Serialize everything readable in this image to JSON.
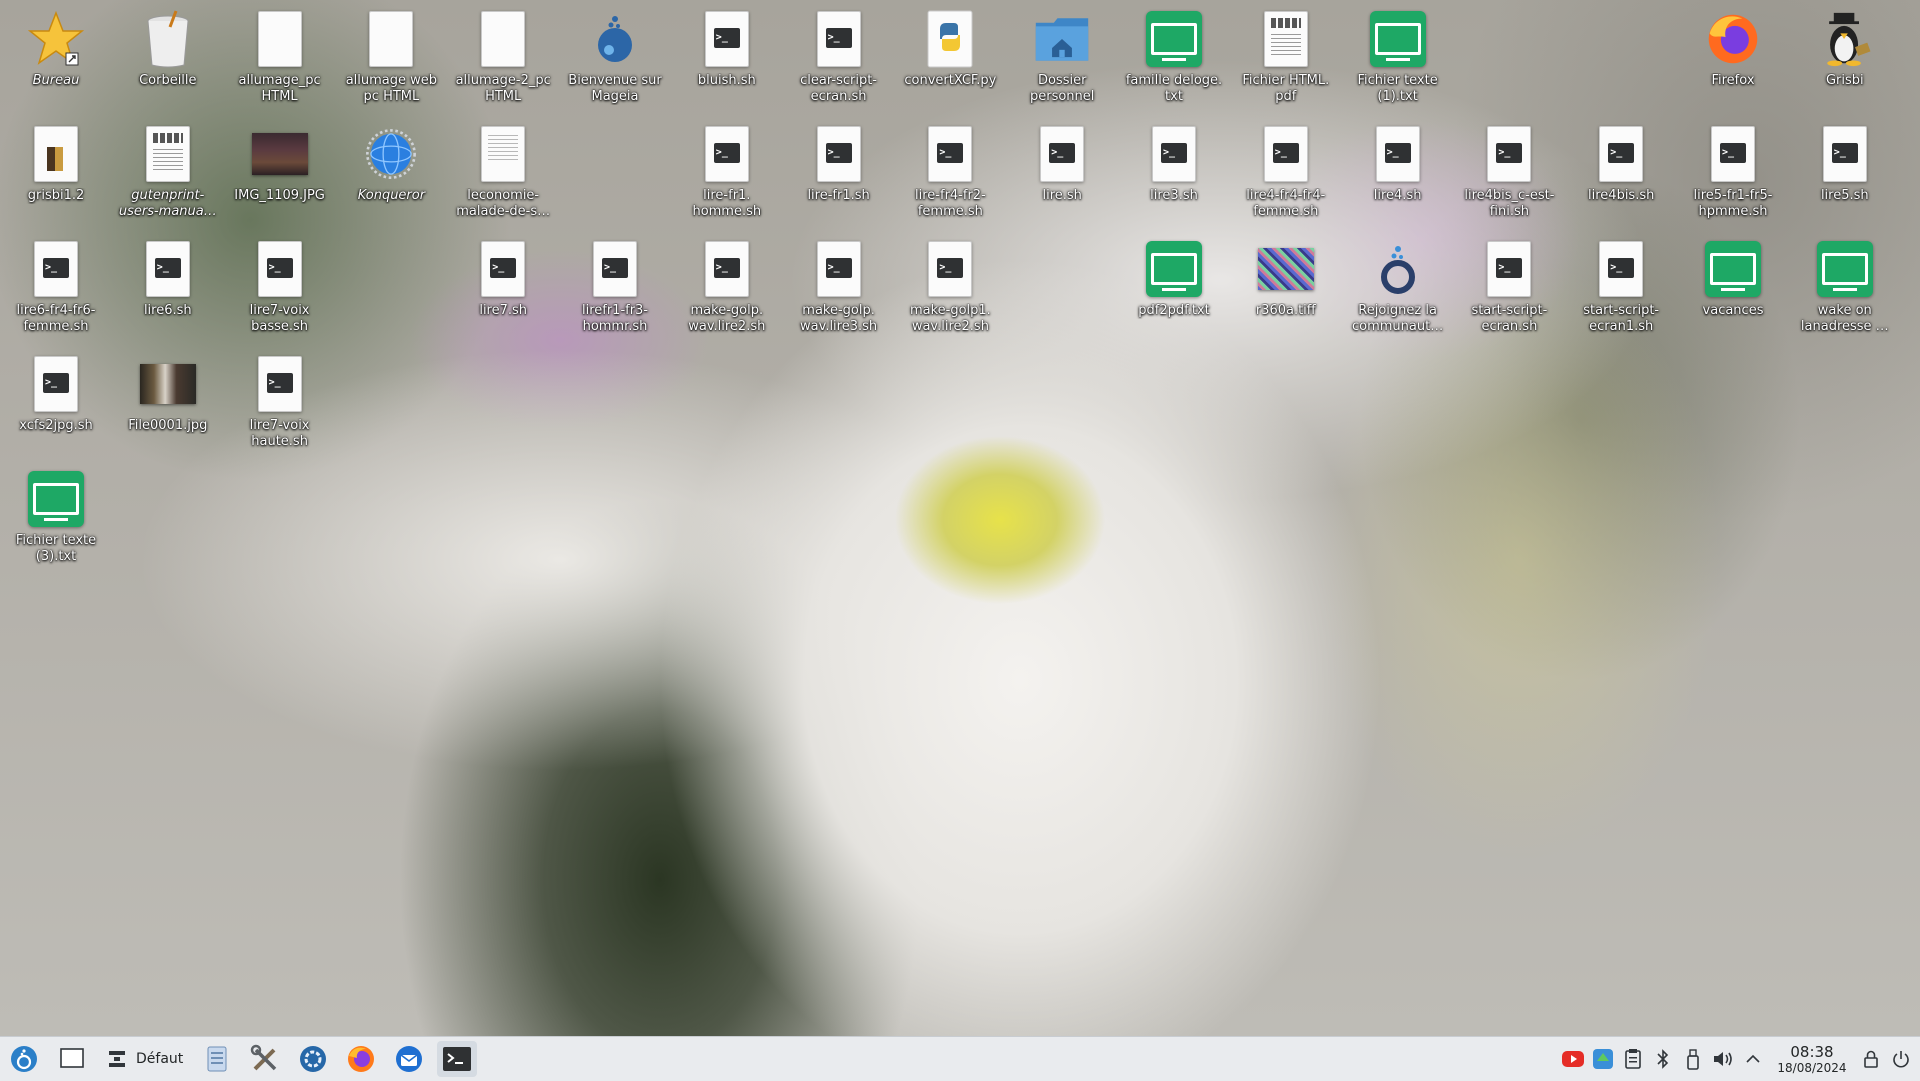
{
  "desktop": {
    "icons": [
      {
        "label": "Bureau",
        "type": "star",
        "col": 0,
        "row": 0,
        "italic": true
      },
      {
        "label": "Corbeille",
        "type": "trash",
        "col": 1,
        "row": 0
      },
      {
        "label": "allumage_pc HTML",
        "type": "page",
        "col": 2,
        "row": 0
      },
      {
        "label": "allumage web pc HTML",
        "type": "page",
        "col": 3,
        "row": 0
      },
      {
        "label": "allumage-2_pc HTML",
        "type": "page",
        "col": 4,
        "row": 0
      },
      {
        "label": "Bienvenue sur Mageia",
        "type": "mageia",
        "col": 5,
        "row": 0
      },
      {
        "label": "bluish.sh",
        "type": "script",
        "col": 6,
        "row": 0
      },
      {
        "label": "clear-script-ecran.sh",
        "type": "script",
        "col": 7,
        "row": 0
      },
      {
        "label": "convertXCF.py",
        "type": "python",
        "col": 8,
        "row": 0
      },
      {
        "label": "Dossier personnel",
        "type": "home",
        "col": 9,
        "row": 0
      },
      {
        "label": "famille deloge. txt",
        "type": "green",
        "col": 10,
        "row": 0
      },
      {
        "label": "Fichier HTML. pdf",
        "type": "pdfdoc",
        "col": 11,
        "row": 0
      },
      {
        "label": "Fichier texte (1).txt",
        "type": "green",
        "col": 12,
        "row": 0
      },
      {
        "label": "Firefox",
        "type": "firefox",
        "col": 15,
        "row": 0
      },
      {
        "label": "Grisbi",
        "type": "tux",
        "col": 16,
        "row": 0
      },
      {
        "label": "grisbi1.2",
        "type": "grisbi",
        "col": 0,
        "row": 1
      },
      {
        "label": "gutenprint-users-manua…",
        "type": "pdfdoc",
        "col": 1,
        "row": 1,
        "italic": true
      },
      {
        "label": "IMG_1109.JPG",
        "type": "photo",
        "col": 2,
        "row": 1
      },
      {
        "label": "Konqueror",
        "type": "konqueror",
        "col": 3,
        "row": 1,
        "italic": true
      },
      {
        "label": "leconomie-malade-de-s…",
        "type": "page-lines",
        "col": 4,
        "row": 1
      },
      {
        "label": "lire-fr1. homme.sh",
        "type": "script",
        "col": 6,
        "row": 1
      },
      {
        "label": "lire-fr1.sh",
        "type": "script",
        "col": 7,
        "row": 1
      },
      {
        "label": "lire-fr4-fr2-femme.sh",
        "type": "script",
        "col": 8,
        "row": 1
      },
      {
        "label": "lire.sh",
        "type": "script",
        "col": 9,
        "row": 1
      },
      {
        "label": "lire3.sh",
        "type": "script",
        "col": 10,
        "row": 1
      },
      {
        "label": "lire4-fr4-fr4-femme.sh",
        "type": "script",
        "col": 11,
        "row": 1
      },
      {
        "label": "lire4.sh",
        "type": "script",
        "col": 12,
        "row": 1
      },
      {
        "label": "lire4bis_c-est-fini.sh",
        "type": "script",
        "col": 13,
        "row": 1
      },
      {
        "label": "lire4bis.sh",
        "type": "script",
        "col": 14,
        "row": 1
      },
      {
        "label": "lire5-fr1-fr5-hpmme.sh",
        "type": "script",
        "col": 15,
        "row": 1
      },
      {
        "label": "lire5.sh",
        "type": "script",
        "col": 16,
        "row": 1
      },
      {
        "label": "lire6-fr4-fr6-femme.sh",
        "type": "script",
        "col": 0,
        "row": 2
      },
      {
        "label": "lire6.sh",
        "type": "script",
        "col": 1,
        "row": 2
      },
      {
        "label": "lire7-voix basse.sh",
        "type": "script",
        "col": 2,
        "row": 2
      },
      {
        "label": "lire7.sh",
        "type": "script",
        "col": 4,
        "row": 2
      },
      {
        "label": "lirefr1-fr3-hommr.sh",
        "type": "script",
        "col": 5,
        "row": 2
      },
      {
        "label": "make-golp. wav.lire2.sh",
        "type": "script",
        "col": 6,
        "row": 2
      },
      {
        "label": "make-golp. wav.lire3.sh",
        "type": "script",
        "col": 7,
        "row": 2
      },
      {
        "label": "make-golp1. wav.lire2.sh",
        "type": "script",
        "col": 8,
        "row": 2
      },
      {
        "label": "pdf2pdf.txt",
        "type": "green",
        "col": 10,
        "row": 2
      },
      {
        "label": "r360a.tiff",
        "type": "tiff",
        "col": 11,
        "row": 2
      },
      {
        "label": "Rejoignez la communaut…",
        "type": "ring",
        "col": 12,
        "row": 2
      },
      {
        "label": "start-script-ecran.sh",
        "type": "script",
        "col": 13,
        "row": 2
      },
      {
        "label": "start-script-ecran1.sh",
        "type": "script",
        "col": 14,
        "row": 2
      },
      {
        "label": "vacances",
        "type": "green",
        "col": 15,
        "row": 2
      },
      {
        "label": "wake on lanadresse …",
        "type": "green",
        "col": 16,
        "row": 2
      },
      {
        "label": "xcfs2jpg.sh",
        "type": "script",
        "col": 0,
        "row": 3
      },
      {
        "label": "File0001.jpg",
        "type": "photo2",
        "col": 1,
        "row": 3
      },
      {
        "label": "lire7-voix haute.sh",
        "type": "script",
        "col": 2,
        "row": 3
      },
      {
        "label": "Fichier texte (3).txt",
        "type": "green",
        "col": 0,
        "row": 4
      }
    ]
  },
  "taskbar": {
    "activity_label": "Défaut",
    "clock_time": "08:38",
    "clock_date": "18/08/2024"
  }
}
